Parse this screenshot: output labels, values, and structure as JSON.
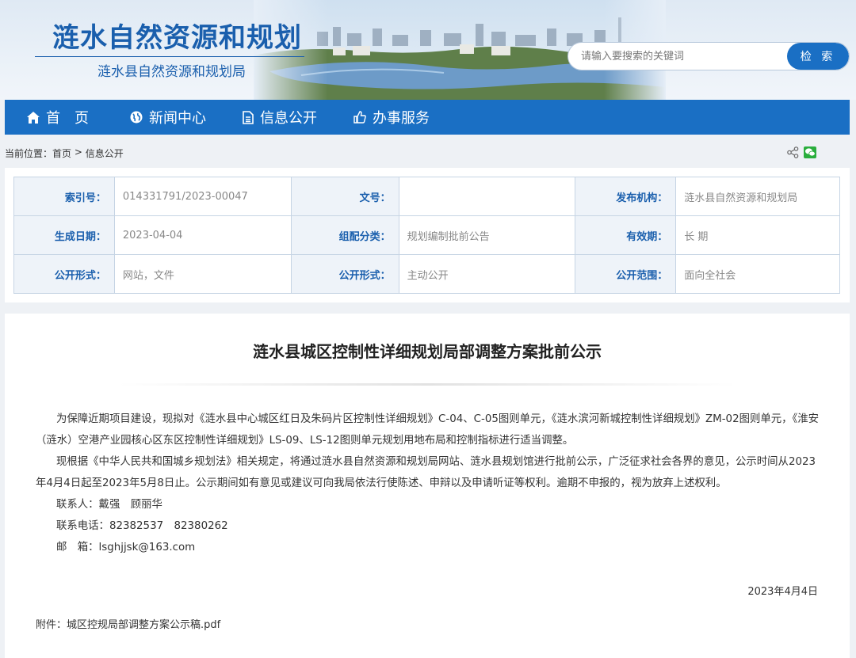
{
  "header": {
    "site_title": "涟水自然资源和规划",
    "site_subtitle": "涟水县自然资源和规划局",
    "search_placeholder": "请输入要搜索的关键词",
    "search_button": "检 索"
  },
  "nav": {
    "items": [
      {
        "label": "首　页",
        "icon": "home-icon"
      },
      {
        "label": "新闻中心",
        "icon": "globe-icon"
      },
      {
        "label": "信息公开",
        "icon": "document-icon"
      },
      {
        "label": "办事服务",
        "icon": "thumbs-up-icon"
      }
    ]
  },
  "breadcrumb": {
    "prefix": "当前位置：",
    "home": "首页",
    "sep": " > ",
    "current": "信息公开"
  },
  "meta": {
    "rows": [
      [
        {
          "k": "索引号：",
          "v": "014331791/2023-00047"
        },
        {
          "k": "文号：",
          "v": ""
        },
        {
          "k": "发布机构：",
          "v": "涟水县自然资源和规划局"
        }
      ],
      [
        {
          "k": "生成日期：",
          "v": "2023-04-04"
        },
        {
          "k": "组配分类：",
          "v": "规划编制批前公告"
        },
        {
          "k": "有效期：",
          "v": "长 期"
        }
      ],
      [
        {
          "k": "公开形式：",
          "v": "网站，文件"
        },
        {
          "k": "公开形式：",
          "v": "主动公开"
        },
        {
          "k": "公开范围：",
          "v": "面向全社会"
        }
      ]
    ]
  },
  "article": {
    "title": "涟水县城区控制性详细规划局部调整方案批前公示",
    "paragraphs": [
      "为保障近期项目建设，现拟对《涟水县中心城区红日及朱码片区控制性详细规划》C-04、C-05图则单元，《涟水滨河新城控制性详细规划》ZM-02图则单元，《淮安（涟水）空港产业园核心区东区控制性详细规划》LS-09、LS-12图则单元规划用地布局和控制指标进行适当调整。",
      "现根据《中华人民共和国城乡规划法》相关规定，将通过涟水县自然资源和规划局网站、涟水县规划馆进行批前公示，广泛征求社会各界的意见，公示时间从2023年4月4日起至2023年5月8日止。公示期间如有意见或建议可向我局依法行使陈述、申辩以及申请听证等权利。逾期不申报的，视为放弃上述权利。",
      "联系人：戴强　顾丽华",
      "联系电话：82382537　82380262",
      "邮　箱：lsghjjsk@163.com"
    ],
    "date": "2023年4月4日",
    "attachment_label": "附件：",
    "attachment_name": "城区控规局部调整方案公示稿.pdf"
  },
  "colors": {
    "brand_blue": "#1a6fc4",
    "title_blue": "#1a5fad"
  }
}
